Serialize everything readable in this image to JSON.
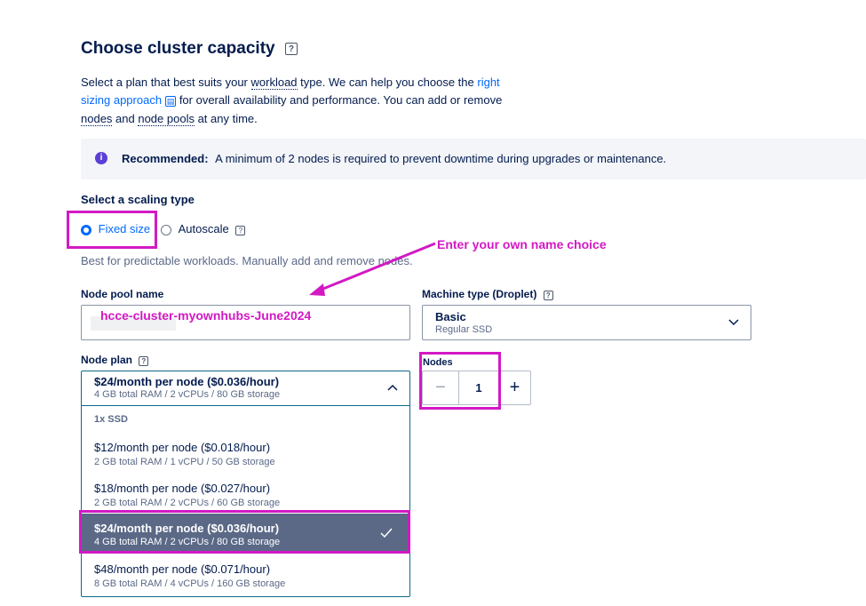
{
  "title": "Choose cluster capacity",
  "help_glyph": "?",
  "intro": {
    "p1": "Select a plan that best suits your ",
    "workload": "workload",
    "p2": " type. We can help you choose the ",
    "link": "right sizing approach",
    "p3": " for overall availability and performance. You can add or remove ",
    "nodes": "nodes",
    "p4": " and ",
    "node_pools": "node pools",
    "p5": " at any time."
  },
  "banner": {
    "icon": "info-icon",
    "label": "Recommended:",
    "text": "A minimum of 2 nodes is required to prevent downtime during upgrades or maintenance."
  },
  "scaling": {
    "label": "Select a scaling type",
    "options": [
      "Fixed size",
      "Autoscale"
    ],
    "selected": "Fixed size",
    "description": "Best for predictable workloads. Manually add and remove nodes."
  },
  "annotation": {
    "text": "Enter your own name choice",
    "color": "#d319c4"
  },
  "node_pool": {
    "label": "Node pool name",
    "value": "hcce-cluster-myownhubs-June2024"
  },
  "machine_type": {
    "label": "Machine type (Droplet)",
    "value": "Basic",
    "sub": "Regular SSD"
  },
  "nodes": {
    "label": "Nodes",
    "value": "1",
    "minus": "−",
    "plus": "+"
  },
  "node_plan": {
    "label": "Node plan",
    "selected_title": "$24/month per node ($0.036/hour)",
    "selected_sub": "4 GB total RAM / 2 vCPUs / 80 GB storage",
    "group": "1x SSD",
    "options": [
      {
        "title": "$12/month per node ($0.018/hour)",
        "sub": "2 GB total RAM / 1 vCPU / 50 GB storage"
      },
      {
        "title": "$18/month per node ($0.027/hour)",
        "sub": "2 GB total RAM / 2 vCPUs / 60 GB storage"
      },
      {
        "title": "$24/month per node ($0.036/hour)",
        "sub": "4 GB total RAM / 2 vCPUs / 80 GB storage"
      },
      {
        "title": "$48/month per node ($0.071/hour)",
        "sub": "8 GB total RAM / 4 vCPUs / 160 GB storage"
      }
    ]
  },
  "colors": {
    "accent": "#0069ff",
    "highlight": "#d319c4",
    "selected_row": "#5b6987",
    "text": "#031b4e"
  }
}
